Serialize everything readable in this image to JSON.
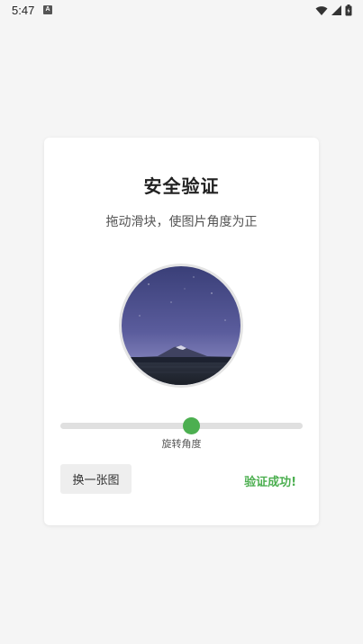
{
  "status_bar": {
    "time": "5:47",
    "notification_icon": "A",
    "icons": [
      "wifi-icon",
      "signal-icon",
      "battery-icon"
    ]
  },
  "dialog": {
    "title": "安全验证",
    "subtitle": "拖动滑块，使图片角度为正",
    "image": {
      "description_icon": "mountain-night-sky-image"
    },
    "slider": {
      "label": "旋转角度",
      "value_fraction": 0.54
    },
    "refresh_button_label": "换一张图",
    "result_text": "验证成功!"
  },
  "colors": {
    "accent": "#4caf50",
    "background": "#f5f5f5",
    "card": "#ffffff",
    "track": "#e0e0e0"
  }
}
